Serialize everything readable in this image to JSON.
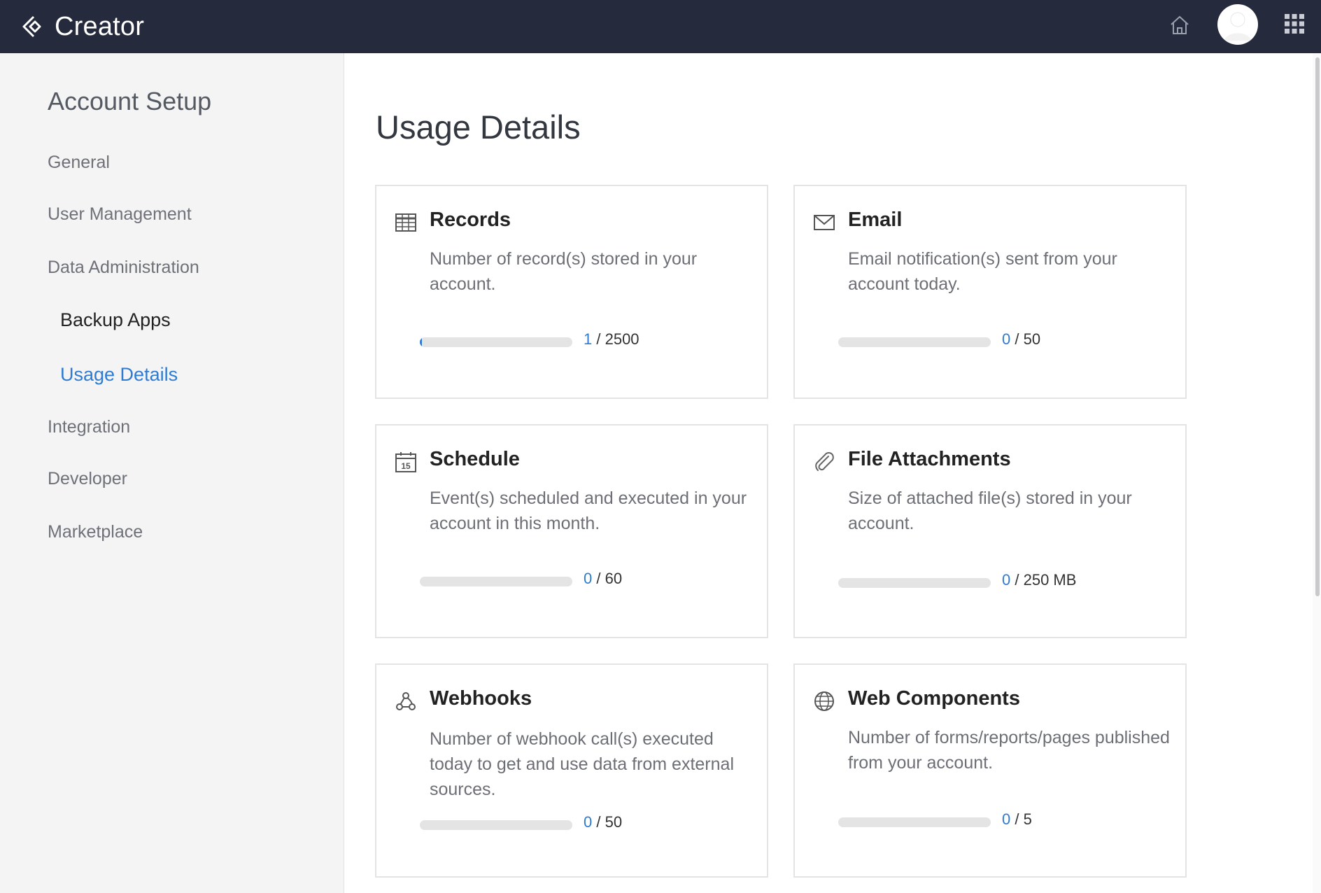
{
  "app": {
    "name": "Creator",
    "icons": {
      "logo": "creator-logo-icon",
      "home": "home-icon",
      "avatar": "user-avatar",
      "apps": "app-grid-icon"
    }
  },
  "sidebar": {
    "title": "Account Setup",
    "items": [
      {
        "label": "General",
        "level": 1,
        "active": false
      },
      {
        "label": "User Management",
        "level": 1,
        "active": false
      },
      {
        "label": "Data Administration",
        "level": 1,
        "active": false
      },
      {
        "label": "Backup Apps",
        "level": 2,
        "active": false
      },
      {
        "label": "Usage Details",
        "level": 2,
        "active": true
      },
      {
        "label": "Integration",
        "level": 1,
        "active": false
      },
      {
        "label": "Developer",
        "level": 1,
        "active": false
      },
      {
        "label": "Marketplace",
        "level": 1,
        "active": false
      }
    ]
  },
  "main": {
    "title": "Usage Details",
    "cards": [
      {
        "title": "Records",
        "icon": "table-icon",
        "description": "Number of record(s) stored in your account.",
        "used": "1",
        "limit": "/ 2500",
        "progress": 0.0004
      },
      {
        "title": "Email",
        "icon": "envelope-icon",
        "description": "Email notification(s) sent from your account today.",
        "used": "0",
        "limit": "/ 50",
        "progress": 0
      },
      {
        "title": "Schedule",
        "icon": "calendar-icon",
        "description": "Event(s) scheduled and executed in your account in this month.",
        "used": "0",
        "limit": "/ 60",
        "progress": 0
      },
      {
        "title": "File Attachments",
        "icon": "paperclip-icon",
        "description": "Size of attached file(s) stored in your account.",
        "used": "0",
        "limit": "/ 250 MB",
        "progress": 0
      },
      {
        "title": "Webhooks",
        "icon": "webhook-icon",
        "description": "Number of webhook call(s) executed today to get and use data from external sources.",
        "used": "0",
        "limit": "/ 50",
        "progress": 0
      },
      {
        "title": "Web Components",
        "icon": "globe-icon",
        "description": "Number of forms/reports/pages published from your account.",
        "used": "0",
        "limit": "/ 5",
        "progress": 0
      }
    ]
  },
  "colors": {
    "topbar": "#252b3c",
    "accent": "#2f7bd1",
    "sidebar_bg": "#f4f4f5",
    "bar_track": "#e4e4e5"
  }
}
